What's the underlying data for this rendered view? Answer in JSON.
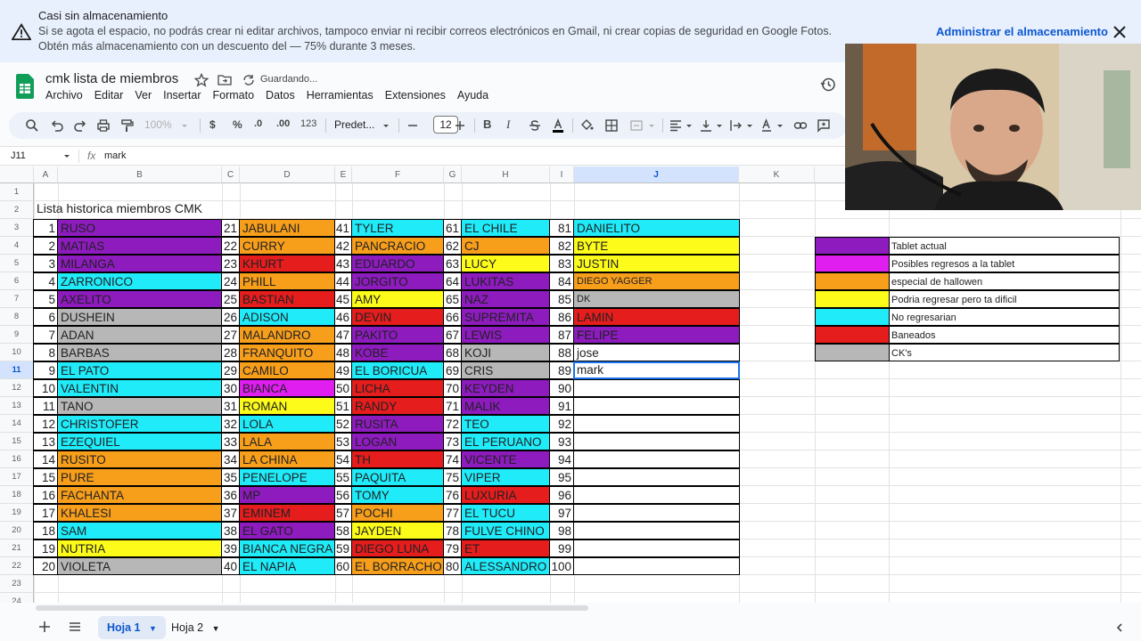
{
  "banner": {
    "title": "Casi sin almacenamiento",
    "text": "Si se agota el espacio, no podrás crear ni editar archivos, tampoco enviar ni recibir correos electrónicos en Gmail, ni crear copias de seguridad en Google Fotos. Obtén más almacenamiento con un descuento del — 75% durante 3 meses.",
    "action": "Administrar el almacenamiento",
    "icon": "warning-icon",
    "close_icon": "close-icon"
  },
  "doc": {
    "title": "cmk lista de miembros",
    "status": "Guardando..."
  },
  "menu": [
    "Archivo",
    "Editar",
    "Ver",
    "Insertar",
    "Formato",
    "Datos",
    "Herramientas",
    "Extensiones",
    "Ayuda"
  ],
  "toolbar": {
    "zoom": "100%",
    "currency": "$",
    "percent": "%",
    "decimals_dec": ".0",
    "decimals_inc": ".00",
    "number_format": "123",
    "font": "Predet...",
    "font_size": "12"
  },
  "formula_bar": {
    "name_box": "J11",
    "fx": "fx",
    "value": "mark"
  },
  "columns": [
    "A",
    "B",
    "C",
    "D",
    "E",
    "F",
    "G",
    "H",
    "I",
    "J",
    "K"
  ],
  "selected_column": "J",
  "rows": [
    "1",
    "2",
    "3",
    "4",
    "5",
    "6",
    "7",
    "8",
    "9",
    "10",
    "11",
    "12",
    "13",
    "14",
    "15",
    "16",
    "17",
    "18",
    "19",
    "20",
    "21",
    "22",
    "23",
    "24"
  ],
  "selected_row": "11",
  "sheet_title": "Lista historica miembros CMK",
  "colors": {
    "purple": "#8e1bbd",
    "cyan": "#20ecf9",
    "orange": "#f79e1b",
    "yellow": "#fdfb19",
    "gray": "#b7b7b7",
    "red": "#e51d1d",
    "magenta": "#e01ef0",
    "white": "#ffffff",
    "accent": "#1a73e8"
  },
  "members": [
    [
      [
        "1",
        "RUSO",
        "purple"
      ],
      [
        "21",
        "JABULANI",
        "orange"
      ],
      [
        "41",
        "TYLER",
        "cyan"
      ],
      [
        "61",
        "EL CHILE",
        "cyan"
      ],
      [
        "81",
        "DANIELITO",
        "cyan"
      ]
    ],
    [
      [
        "2",
        "MATIAS",
        "purple"
      ],
      [
        "22",
        "CURRY",
        "orange"
      ],
      [
        "42",
        "PANCRACIO",
        "orange"
      ],
      [
        "62",
        "CJ",
        "orange"
      ],
      [
        "82",
        "BYTE",
        "yellow"
      ]
    ],
    [
      [
        "3",
        "MILANGA",
        "purple"
      ],
      [
        "23",
        "KHURT",
        "red"
      ],
      [
        "43",
        "EDUARDO",
        "purple"
      ],
      [
        "63",
        "LUCY",
        "yellow"
      ],
      [
        "83",
        "JUSTIN",
        "yellow"
      ]
    ],
    [
      [
        "4",
        "ZARRONICO",
        "cyan"
      ],
      [
        "24",
        "PHILL",
        "orange"
      ],
      [
        "44",
        "JORGITO",
        "purple"
      ],
      [
        "64",
        "LUKITAS",
        "purple"
      ],
      [
        "84",
        "DIEGO YAGGER",
        "orange"
      ]
    ],
    [
      [
        "5",
        "AXELITO",
        "purple"
      ],
      [
        "25",
        "BASTIAN",
        "red"
      ],
      [
        "45",
        "AMY",
        "yellow"
      ],
      [
        "65",
        "NAZ",
        "purple"
      ],
      [
        "85",
        "DK",
        "gray"
      ]
    ],
    [
      [
        "6",
        "DUSHEIN",
        "gray"
      ],
      [
        "26",
        "ADISON",
        "cyan"
      ],
      [
        "46",
        "DEVIN",
        "red"
      ],
      [
        "66",
        "SUPREMITA",
        "purple"
      ],
      [
        "86",
        "LAMIN",
        "red"
      ]
    ],
    [
      [
        "7",
        "ADAN",
        "gray"
      ],
      [
        "27",
        "MALANDRO",
        "orange"
      ],
      [
        "47",
        "PAKITO",
        "purple"
      ],
      [
        "67",
        "LEWIS",
        "purple"
      ],
      [
        "87",
        "FELIPE",
        "purple"
      ]
    ],
    [
      [
        "8",
        "BARBAS",
        "gray"
      ],
      [
        "28",
        "FRANQUITO",
        "orange"
      ],
      [
        "48",
        "KOBE",
        "purple"
      ],
      [
        "68",
        "KOJI",
        "gray"
      ],
      [
        "88",
        "jose",
        "white"
      ]
    ],
    [
      [
        "9",
        "EL PATO",
        "cyan"
      ],
      [
        "29",
        "CAMILO",
        "orange"
      ],
      [
        "49",
        "EL BORICUA",
        "cyan"
      ],
      [
        "69",
        "CRIS",
        "gray"
      ],
      [
        "89",
        "mark",
        "white"
      ]
    ],
    [
      [
        "10",
        "VALENTIN",
        "cyan"
      ],
      [
        "30",
        "BIANCA",
        "magenta"
      ],
      [
        "50",
        "LICHA",
        "red"
      ],
      [
        "70",
        "KEYDEN",
        "purple"
      ],
      [
        "90",
        "",
        "white"
      ]
    ],
    [
      [
        "11",
        "TANO",
        "gray"
      ],
      [
        "31",
        "ROMAN",
        "yellow"
      ],
      [
        "51",
        "RANDY",
        "red"
      ],
      [
        "71",
        "MALIK",
        "purple"
      ],
      [
        "91",
        "",
        "white"
      ]
    ],
    [
      [
        "12",
        "CHRISTOFER",
        "cyan"
      ],
      [
        "32",
        "LOLA",
        "cyan"
      ],
      [
        "52",
        "RUSITA",
        "purple"
      ],
      [
        "72",
        "TEO",
        "cyan"
      ],
      [
        "92",
        "",
        "white"
      ]
    ],
    [
      [
        "13",
        "EZEQUIEL",
        "cyan"
      ],
      [
        "33",
        "LALA",
        "orange"
      ],
      [
        "53",
        "LOGAN",
        "purple"
      ],
      [
        "73",
        "EL PERUANO",
        "cyan"
      ],
      [
        "93",
        "",
        "white"
      ]
    ],
    [
      [
        "14",
        "RUSITO",
        "orange"
      ],
      [
        "34",
        "LA CHINA",
        "orange"
      ],
      [
        "54",
        "TH",
        "red"
      ],
      [
        "74",
        "VICENTE",
        "purple"
      ],
      [
        "94",
        "",
        "white"
      ]
    ],
    [
      [
        "15",
        "PURE",
        "orange"
      ],
      [
        "35",
        "PENELOPE",
        "cyan"
      ],
      [
        "55",
        "PAQUITA",
        "cyan"
      ],
      [
        "75",
        "VIPER",
        "cyan"
      ],
      [
        "95",
        "",
        "white"
      ]
    ],
    [
      [
        "16",
        "FACHANTA",
        "orange"
      ],
      [
        "36",
        "MP",
        "purple"
      ],
      [
        "56",
        "TOMY",
        "cyan"
      ],
      [
        "76",
        "LUXURIA",
        "red"
      ],
      [
        "96",
        "",
        "white"
      ]
    ],
    [
      [
        "17",
        "KHALESI",
        "orange"
      ],
      [
        "37",
        "EMINEM",
        "red"
      ],
      [
        "57",
        "POCHI",
        "orange"
      ],
      [
        "77",
        "EL TUCU",
        "cyan"
      ],
      [
        "97",
        "",
        "white"
      ]
    ],
    [
      [
        "18",
        "SAM",
        "cyan"
      ],
      [
        "38",
        "EL GATO",
        "purple"
      ],
      [
        "58",
        "JAYDEN",
        "yellow"
      ],
      [
        "78",
        "FULVE CHINO",
        "cyan"
      ],
      [
        "98",
        "",
        "white"
      ]
    ],
    [
      [
        "19",
        "NUTRIA",
        "yellow"
      ],
      [
        "39",
        "BIANCA NEGRA",
        "cyan"
      ],
      [
        "59",
        "DIEGO LUNA",
        "red"
      ],
      [
        "79",
        "ET",
        "red"
      ],
      [
        "99",
        "",
        "white"
      ]
    ],
    [
      [
        "20",
        "VIOLETA",
        "gray"
      ],
      [
        "40",
        "EL NAPIA",
        "cyan"
      ],
      [
        "60",
        "EL BORRACHO",
        "orange"
      ],
      [
        "80",
        "ALESSANDRO",
        "cyan"
      ],
      [
        "100",
        "",
        "white"
      ]
    ]
  ],
  "legend": [
    {
      "color": "purple",
      "label": "Tablet actual"
    },
    {
      "color": "magenta",
      "label": "Posibles regresos a la tablet"
    },
    {
      "color": "orange",
      "label": "especial de hallowen"
    },
    {
      "color": "yellow",
      "label": "Podria regresar pero ta dificil"
    },
    {
      "color": "cyan",
      "label": "No regresarian"
    },
    {
      "color": "red",
      "label": "Baneados"
    },
    {
      "color": "gray",
      "label": "CK's"
    }
  ],
  "sheets": [
    {
      "label": "Hoja 1",
      "active": true
    },
    {
      "label": "Hoja 2",
      "active": false
    }
  ]
}
